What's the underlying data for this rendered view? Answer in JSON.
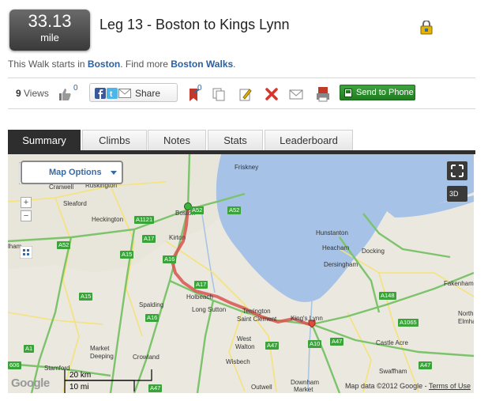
{
  "distance": {
    "value": "33.13",
    "unit": "mile"
  },
  "title": "Leg 13 - Boston to Kings Lynn",
  "intro": {
    "prefix": "This Walk starts in ",
    "start_link": "Boston",
    "middle": ". Find more ",
    "more_link": "Boston Walks",
    "suffix": "."
  },
  "toolbar": {
    "views_count": "9",
    "views_label": " Views",
    "likes_count": "0",
    "share_label": "Share",
    "bookmarks_count": "0",
    "send_to_phone_label": "Send to Phone"
  },
  "tabs": [
    {
      "label": "Summary",
      "active": true
    },
    {
      "label": "Climbs"
    },
    {
      "label": "Notes"
    },
    {
      "label": "Stats"
    },
    {
      "label": "Leaderboard"
    }
  ],
  "map": {
    "options_label": "Map Options",
    "btn_3d": "3D",
    "scale_km": "20 km",
    "scale_mi": "10 mi",
    "google_label": "Google",
    "attribution": "Map data ©2012 Google - ",
    "terms_label": "Terms of Use",
    "places": {
      "friskney": "Friskney",
      "cranwell": "Cranwell",
      "ruskington": "Ruskington",
      "sleaford": "Sleaford",
      "boston": "Boston",
      "heckington": "Heckington",
      "kirton": "Kirton",
      "lham": "lham",
      "hunstanton": "Hunstanton",
      "heacham": "Heacham",
      "docking": "Docking",
      "dersingham": "Dersingham",
      "holbeach": "Holbeach",
      "spalding": "Spalding",
      "long_sutton": "Long Sutton",
      "terrington": "Terrington",
      "saint_clement": "Saint Clement",
      "kings_lynn": "King's Lynn",
      "fakenham": "Fakenham",
      "north_elmham": "North",
      "elmha": "Elmha",
      "west_walton": "West",
      "walton": "Walton",
      "wisbech": "Wisbech",
      "castle_acre": "Castle Acre",
      "market_deeping": "Market",
      "deeping": "Deeping",
      "crowland": "Crowland",
      "stamford": "Stamford",
      "swaffham": "Swaffham",
      "downham": "Downham",
      "market2": "Market",
      "outwell": "Outwell"
    },
    "roads": {
      "a52a": "A52",
      "a52b": "A52",
      "a1121": "A1121",
      "a17a": "A17",
      "a16a": "A16",
      "a52c": "A52",
      "a15a": "A15",
      "a16b": "A16",
      "a17b": "A17",
      "a15b": "A15",
      "a148": "A148",
      "a1065": "A1065",
      "a47a": "A47",
      "a10": "A10",
      "a47b": "A47",
      "a1": "A1",
      "a47c": "A47",
      "a606": "606",
      "a47d": "A47"
    }
  },
  "colors": {
    "accent_blue": "#2a5fa0",
    "route_color": "#d9534f",
    "phone_button": "#2e8b2e",
    "tab_active": "#2e2e2e",
    "sea": "#a6c2e6",
    "road_green": "#3aa33a",
    "road_yellow": "#f5e27a"
  }
}
